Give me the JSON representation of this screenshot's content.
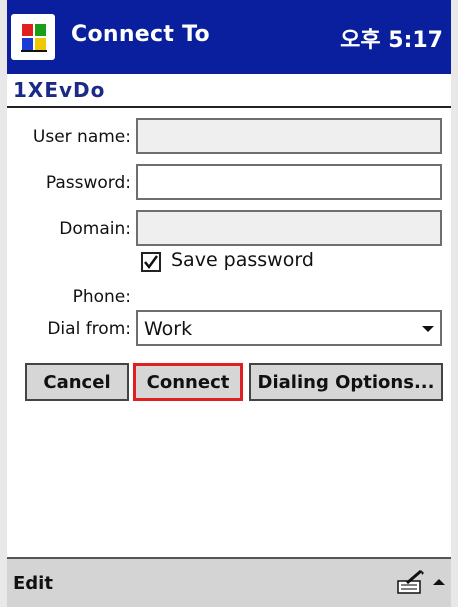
{
  "window": {
    "title": "Connect To",
    "clock": "오후 5:17",
    "start_icon": "windows-flag-icon"
  },
  "connection": {
    "name": "1XEvDo"
  },
  "form": {
    "user_name_label": "User name:",
    "user_name_value": "",
    "password_label": "Password:",
    "password_value": "",
    "domain_label": "Domain:",
    "domain_value": "",
    "save_password_label": "Save password",
    "save_password_checked": true,
    "phone_label": "Phone:",
    "phone_value": "",
    "dial_from_label": "Dial from:",
    "dial_from_value": "Work"
  },
  "buttons": {
    "cancel": "Cancel",
    "connect": "Connect",
    "dialing_options": "Dialing Options..."
  },
  "menubar": {
    "edit": "Edit",
    "input_icon": "keyboard-input-icon",
    "arrow_icon": "up-arrow-icon"
  },
  "colors": {
    "titlebar": "#0a1f9e",
    "connection_name": "#1a2b86",
    "focus_border": "#e02020"
  }
}
